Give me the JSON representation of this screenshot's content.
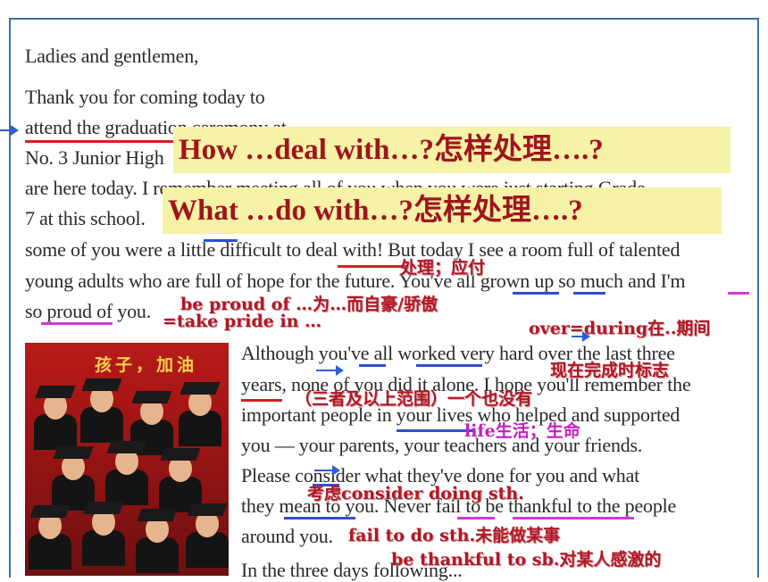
{
  "paragraph_lines": [
    "Ladies and gentlemen,",
    "Thank you for coming today to",
    "attend the graduation ceremony at",
    "No. 3 Junior High",
    "are here today. I remember meeting all of you when you were just starting Grade",
    "7 at this school.",
    "some of you were a little difficult to deal with! But today I see a room full of talented",
    "young adults who are full of hope for the future. You've all grown up so much and I'm",
    "so proud of you.",
    "Although you've all worked very hard over the last three",
    "years, none of you did it alone. I hope you'll remember the",
    "important people in your lives who helped and supported",
    "you — your parents, your teachers and your friends.",
    "Please consider what they've done for you and what",
    "they mean to you. Never fail to be thankful to the people",
    "around you.",
    "In the three days following..."
  ],
  "banners": {
    "how": "How …deal with…?怎样处理….?",
    "what": "What …do with…?怎样处理….?"
  },
  "notes": {
    "deal_with": "处理；应付",
    "proud_of": "be proud of …为…而自豪/骄傲",
    "take_pride": "=take pride in …",
    "over_during": "over=during在..期间",
    "perfect_marker": "现在完成时标志",
    "none_of": "（三者及以上范围）一个也没有",
    "life": "life生活；生命",
    "consider": "考虑consider doing sth.",
    "fail_to": "fail to do sth.未能做某事",
    "thankful": "be thankful to sb.对某人感激的"
  },
  "photo_banner": "孩子，加油",
  "colors": {
    "banner_bg": "#f6f2a6",
    "banner_text": "#a0141e",
    "note_red": "#b01826",
    "note_magenta": "#c41cc4",
    "underline_blue": "#2d4fd6",
    "underline_red": "#d42020"
  }
}
